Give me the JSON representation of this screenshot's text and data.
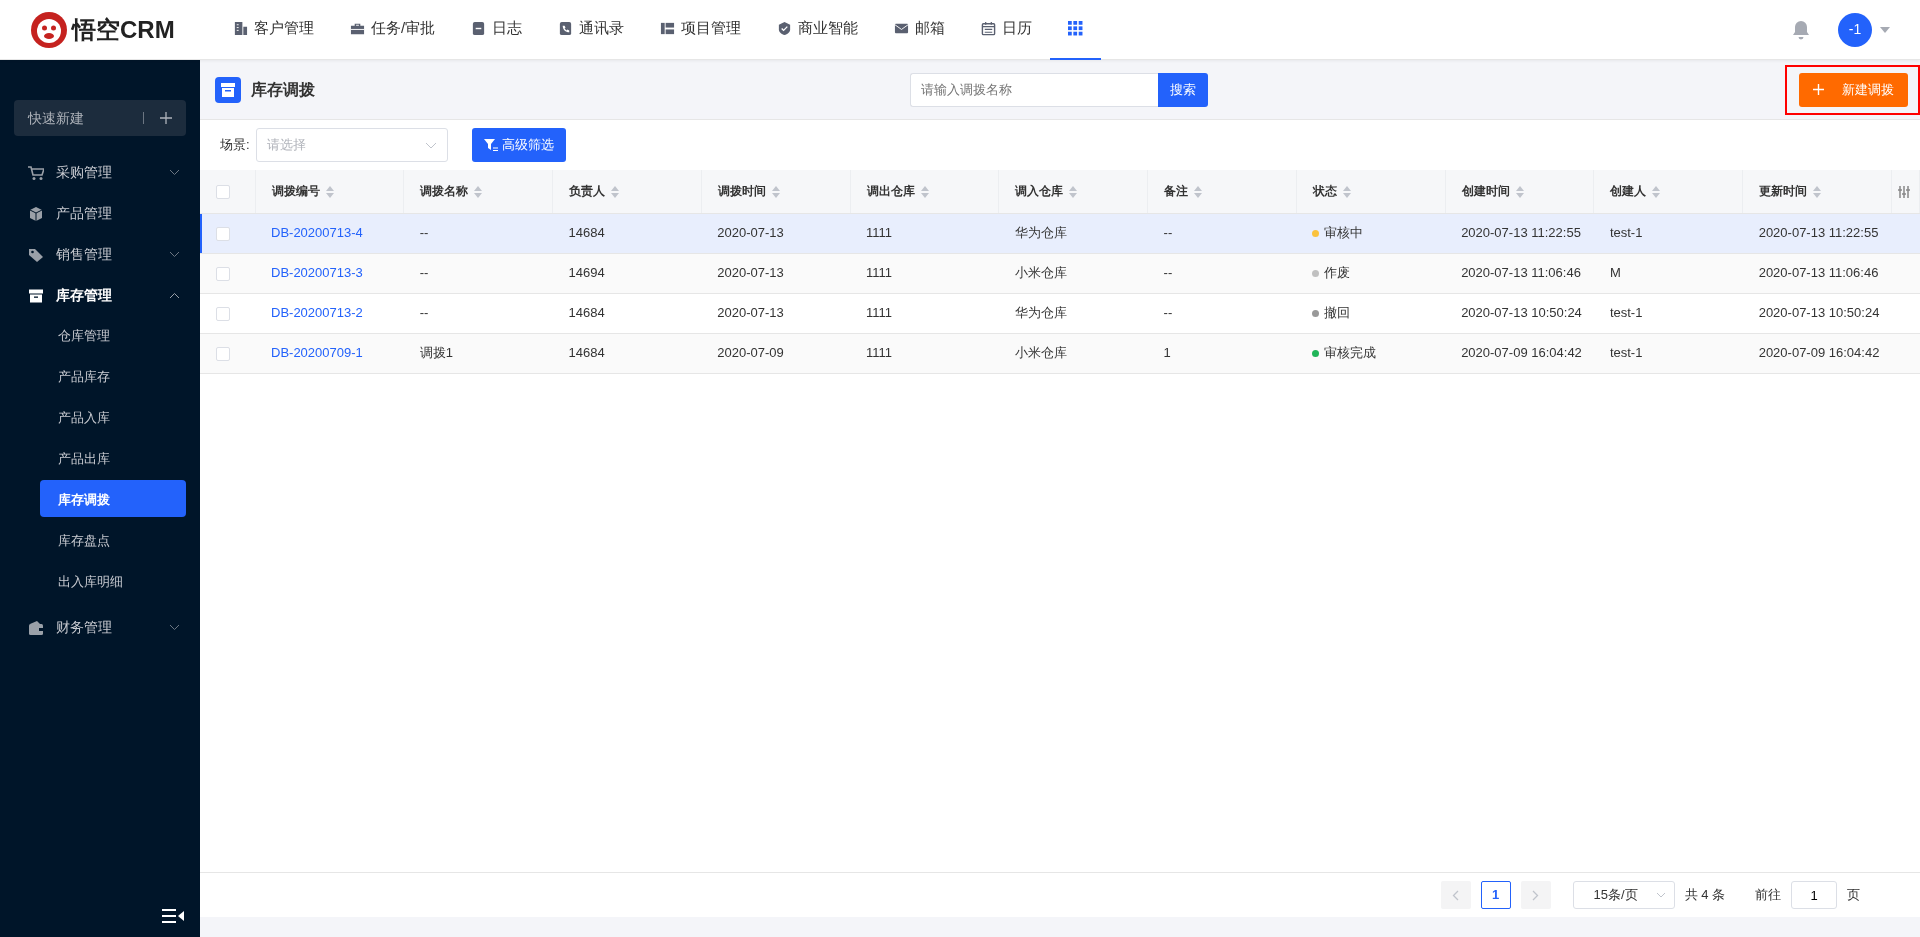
{
  "app": {
    "logo_text": "悟空CRM"
  },
  "top_nav": [
    {
      "label": "客户管理",
      "selected": false
    },
    {
      "label": "任务/审批",
      "selected": false
    },
    {
      "label": "日志",
      "selected": false
    },
    {
      "label": "通讯录",
      "selected": false
    },
    {
      "label": "项目管理",
      "selected": false
    },
    {
      "label": "商业智能",
      "selected": false
    },
    {
      "label": "邮箱",
      "selected": false
    },
    {
      "label": "日历",
      "selected": false
    }
  ],
  "apps_menu": {
    "selected": true
  },
  "user": {
    "avatar_text": "-1"
  },
  "sidebar": {
    "quick_new": "快速新建",
    "items": [
      {
        "label": "采购管理",
        "expanded": false
      },
      {
        "label": "产品管理"
      },
      {
        "label": "销售管理",
        "expanded": false
      },
      {
        "label": "库存管理",
        "expanded": true,
        "children": [
          {
            "label": "仓库管理",
            "selected": false
          },
          {
            "label": "产品库存",
            "selected": false
          },
          {
            "label": "产品入库",
            "selected": false
          },
          {
            "label": "产品出库",
            "selected": false
          },
          {
            "label": "库存调拨",
            "selected": true
          },
          {
            "label": "库存盘点",
            "selected": false
          },
          {
            "label": "出入库明细",
            "selected": false
          }
        ]
      },
      {
        "label": "财务管理",
        "expanded": false
      }
    ]
  },
  "page": {
    "title": "库存调拨",
    "search": {
      "placeholder": "请输入调拨名称",
      "button": "搜索"
    },
    "new_button": "新建调拨"
  },
  "filter": {
    "label": "场景:",
    "select_placeholder": "请选择",
    "advanced_button": "高级筛选"
  },
  "table": {
    "select_all_checked": false,
    "columns": [
      "调拨编号",
      "调拨名称",
      "负责人",
      "调拨时间",
      "调出仓库",
      "调入仓库",
      "备注",
      "状态",
      "创建时间",
      "创建人",
      "更新时间"
    ],
    "rows": [
      {
        "selected": true,
        "checked": false,
        "cells": [
          "DB-20200713-4",
          "--",
          "14684",
          "2020-07-13",
          "1111",
          "华为仓库",
          "--"
        ],
        "status": {
          "label": "审核中",
          "color": "#fac23d"
        },
        "cells_after": [
          "2020-07-13 11:22:55",
          "test-1",
          "2020-07-13 11:22:55"
        ]
      },
      {
        "selected": false,
        "checked": false,
        "cells": [
          "DB-20200713-3",
          "--",
          "14694",
          "2020-07-13",
          "1111",
          "小米仓库",
          "--"
        ],
        "status": {
          "label": "作废",
          "color": "#c0c0c0"
        },
        "cells_after": [
          "2020-07-13 11:06:46",
          "M",
          "2020-07-13 11:06:46"
        ]
      },
      {
        "selected": false,
        "checked": false,
        "cells": [
          "DB-20200713-2",
          "--",
          "14684",
          "2020-07-13",
          "1111",
          "华为仓库",
          "--"
        ],
        "status": {
          "label": "撤回",
          "color": "#999999"
        },
        "cells_after": [
          "2020-07-13 10:50:24",
          "test-1",
          "2020-07-13 10:50:24"
        ]
      },
      {
        "selected": false,
        "checked": false,
        "cells": [
          "DB-20200709-1",
          "调拨1",
          "14684",
          "2020-07-09",
          "1111",
          "小米仓库",
          "1"
        ],
        "status": {
          "label": "审核完成",
          "color": "#20b559"
        },
        "cells_after": [
          "2020-07-09 16:04:42",
          "test-1",
          "2020-07-09 16:04:42"
        ]
      }
    ]
  },
  "pagination": {
    "pages": [
      {
        "label": "1",
        "selected": true
      }
    ],
    "page_size": "15条/页",
    "total": "共 4 条",
    "goto_label": "前往",
    "goto_value": "1",
    "page_unit": "页"
  }
}
